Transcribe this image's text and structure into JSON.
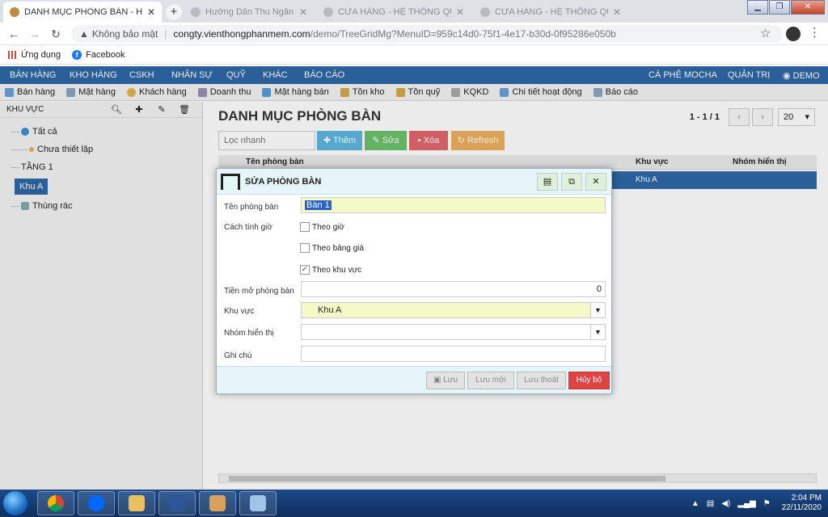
{
  "browser": {
    "active_tab_title": "DANH MỤC PHÒNG BÀN - HỆ T",
    "bg_tabs": [
      "Hướng Dẫn Thu Ngân (Hanh",
      "CỬA HÀNG - HỆ THỐNG QUẢN",
      "CỬA HÀNG - HỆ THỐNG QUẢN"
    ],
    "insecure_label": "Không bảo mật",
    "url_host": "congty.vienthongphanmem.com",
    "url_path": "/demo/TreeGridMg?MenuID=959c14d0-75f1-4e17-b30d-0f95286e050b",
    "bookmarks": [
      "Ứng dụng",
      "Facebook"
    ]
  },
  "appnav": {
    "items": [
      "BÁN HÀNG",
      "KHO HÀNG",
      "CSKH",
      "NHÂN SỰ",
      "QUỸ",
      "KHÁC",
      "BÁO CÁO"
    ],
    "store": "CÀ PHÊ MOCHA",
    "admin": "QUẢN TRỊ",
    "user": "DEMO"
  },
  "toolbar": {
    "items": [
      "Bán hàng",
      "Mặt hàng",
      "Khách hàng",
      "Doanh thu",
      "Mặt hàng bán",
      "Tồn kho",
      "Tồn quỹ",
      "KQKD",
      "Chi tiết hoạt động",
      "Báo cáo"
    ]
  },
  "leftpanel": {
    "title": "KHU VỰC",
    "tree": [
      "Tất cả",
      "Chưa thiết lập",
      "TẦNG 1",
      "Khu A",
      "Thùng rác"
    ]
  },
  "main": {
    "title": "DANH MỤC PHÒNG BÀN",
    "pager_info": "1 - 1 / 1",
    "page_size": "20",
    "search_placeholder": "Lọc nhanh",
    "buttons": {
      "add": "Thêm",
      "edit": "Sửa",
      "delete": "Xóa",
      "refresh": "Refresh"
    },
    "grid": {
      "columns": [
        "Tên phòng bàn",
        "Khu vực",
        "Nhóm hiển thị"
      ],
      "row_area": "Khu A"
    }
  },
  "modal": {
    "title": "SỬA PHÒNG BÀN",
    "fields": {
      "name_label": "Tên phòng bàn",
      "name_value": "Bàn 1",
      "time_label": "Cách tính giờ",
      "opt_hour": "Theo giờ",
      "opt_price": "Theo bảng giá",
      "opt_area": "Theo khu vực",
      "fee_label": "Tiền mở phòng bàn",
      "fee_value": "0",
      "area_label": "Khu vực",
      "area_value": "Khu A",
      "group_label": "Nhóm hiển thị",
      "note_label": "Ghi chú"
    },
    "buttons": {
      "save": "Lưu",
      "save_new": "Lưu mới",
      "save_exit": "Lưu thoát",
      "cancel": "Hủy bỏ"
    }
  },
  "taskbar": {
    "time": "2:04 PM",
    "date": "22/11/2020"
  },
  "colors": {
    "nav_blue": "#2e68a8",
    "btn_add": "#2a9fd6",
    "btn_edit": "#3cae3c",
    "btn_delete": "#d9363e",
    "btn_refresh": "#e8962a",
    "btn_cancel": "#e04343"
  }
}
